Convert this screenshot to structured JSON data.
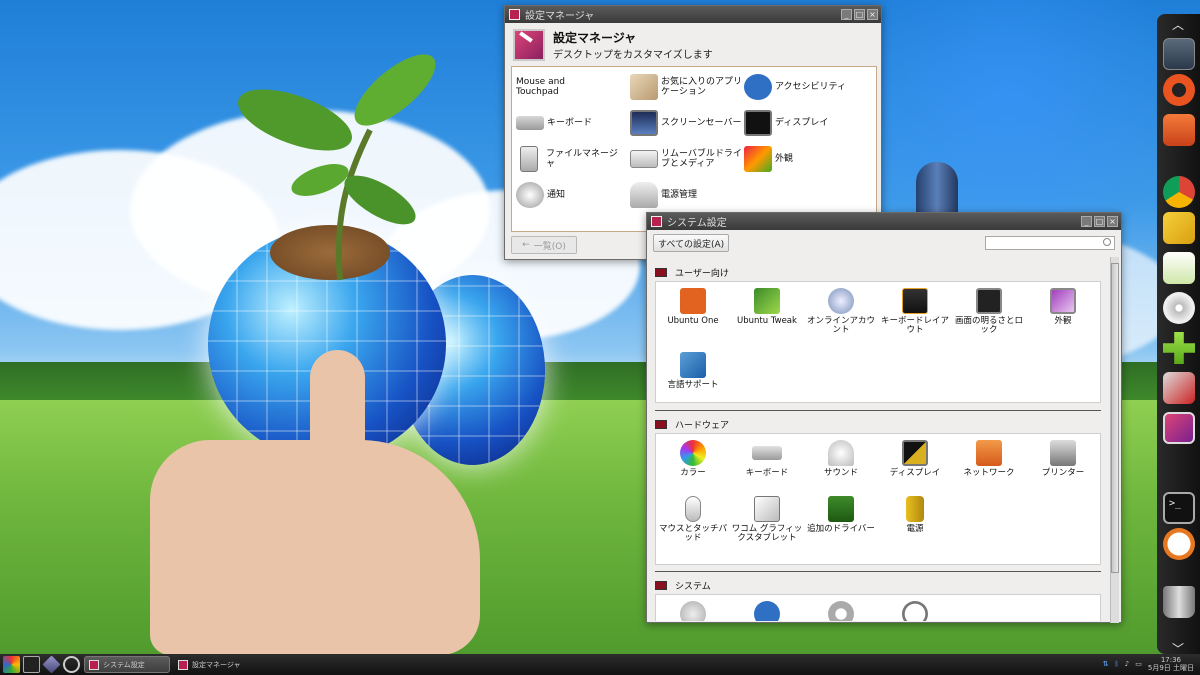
{
  "settings_manager": {
    "window_title": "設定マネージャ",
    "header_title": "設定マネージャ",
    "header_subtitle": "デスクトップをカスタマイズします",
    "items": [
      {
        "label": "Mouse and Touchpad",
        "icon": "mouse-touchpad-icon"
      },
      {
        "label": "お気に入りのアプリケーション",
        "icon": "favorite-apps-icon"
      },
      {
        "label": "アクセシビリティ",
        "icon": "accessibility-icon"
      },
      {
        "label": "キーボード",
        "icon": "keyboard-icon"
      },
      {
        "label": "スクリーンセーバー",
        "icon": "screensaver-icon"
      },
      {
        "label": "ディスプレイ",
        "icon": "display-icon"
      },
      {
        "label": "ファイルマネージャ",
        "icon": "file-manager-icon"
      },
      {
        "label": "リムーバブルドライブとメディア",
        "icon": "removable-drive-icon"
      },
      {
        "label": "外観",
        "icon": "appearance-icon"
      },
      {
        "label": "通知",
        "icon": "notification-icon"
      },
      {
        "label": "電源管理",
        "icon": "power-management-icon"
      }
    ],
    "back_label": "一覧(O)"
  },
  "system_settings": {
    "window_title": "システム設定",
    "all_settings_label": "すべての設定(A)",
    "search_placeholder": "",
    "sections": [
      {
        "title": "ユーザー向け",
        "items": [
          {
            "label": "Ubuntu One",
            "icon": "ubuntu-one-icon"
          },
          {
            "label": "Ubuntu Tweak",
            "icon": "ubuntu-tweak-icon"
          },
          {
            "label": "オンラインアカウント",
            "icon": "online-accounts-icon"
          },
          {
            "label": "キーボードレイアウト",
            "icon": "keyboard-layout-icon"
          },
          {
            "label": "画面の明るさとロック",
            "icon": "brightness-lock-icon"
          },
          {
            "label": "外観",
            "icon": "appearance-icon"
          },
          {
            "label": "言語サポート",
            "icon": "language-support-icon"
          }
        ]
      },
      {
        "title": "ハードウェア",
        "items": [
          {
            "label": "カラー",
            "icon": "color-icon"
          },
          {
            "label": "キーボード",
            "icon": "keyboard-icon"
          },
          {
            "label": "サウンド",
            "icon": "sound-icon"
          },
          {
            "label": "ディスプレイ",
            "icon": "display-icon"
          },
          {
            "label": "ネットワーク",
            "icon": "network-icon"
          },
          {
            "label": "プリンター",
            "icon": "printer-icon"
          },
          {
            "label": "マウスとタッチパッド",
            "icon": "mouse-touchpad-icon"
          },
          {
            "label": "ワコム グラフィックスタブレット",
            "icon": "wacom-tablet-icon"
          },
          {
            "label": "追加のドライバー",
            "icon": "additional-drivers-icon"
          },
          {
            "label": "電源",
            "icon": "power-icon"
          }
        ]
      },
      {
        "title": "システム",
        "items": [
          {
            "label": "",
            "icon": "user-accounts-icon"
          },
          {
            "label": "",
            "icon": "universal-access-icon"
          },
          {
            "label": "",
            "icon": "details-gear-icon"
          },
          {
            "label": "",
            "icon": "time-date-icon"
          }
        ]
      }
    ]
  },
  "taskbar": {
    "tasks": [
      {
        "label": "システム設定",
        "active": true
      },
      {
        "label": "設定マネージャ",
        "active": false
      }
    ],
    "clock_time": "17:36",
    "clock_date": "5月9日 土曜日"
  },
  "dock": {
    "items": [
      "workspace-switcher-icon",
      "ubuntu-logo-icon",
      "file-folder-icon",
      "chrome-browser-icon",
      "text-editor-icon",
      "notes-icon",
      "disc-icon",
      "add-icon",
      "settings-tools-icon",
      "settings-manager-icon",
      "terminal-icon",
      "clock-icon",
      "trash-icon",
      "power-icon"
    ]
  },
  "colors": {
    "section_marker": "#8a1020",
    "title_bar": "#3a3a3a",
    "window_bg": "#efeeec",
    "dock_bg": "#1a1a1a"
  }
}
